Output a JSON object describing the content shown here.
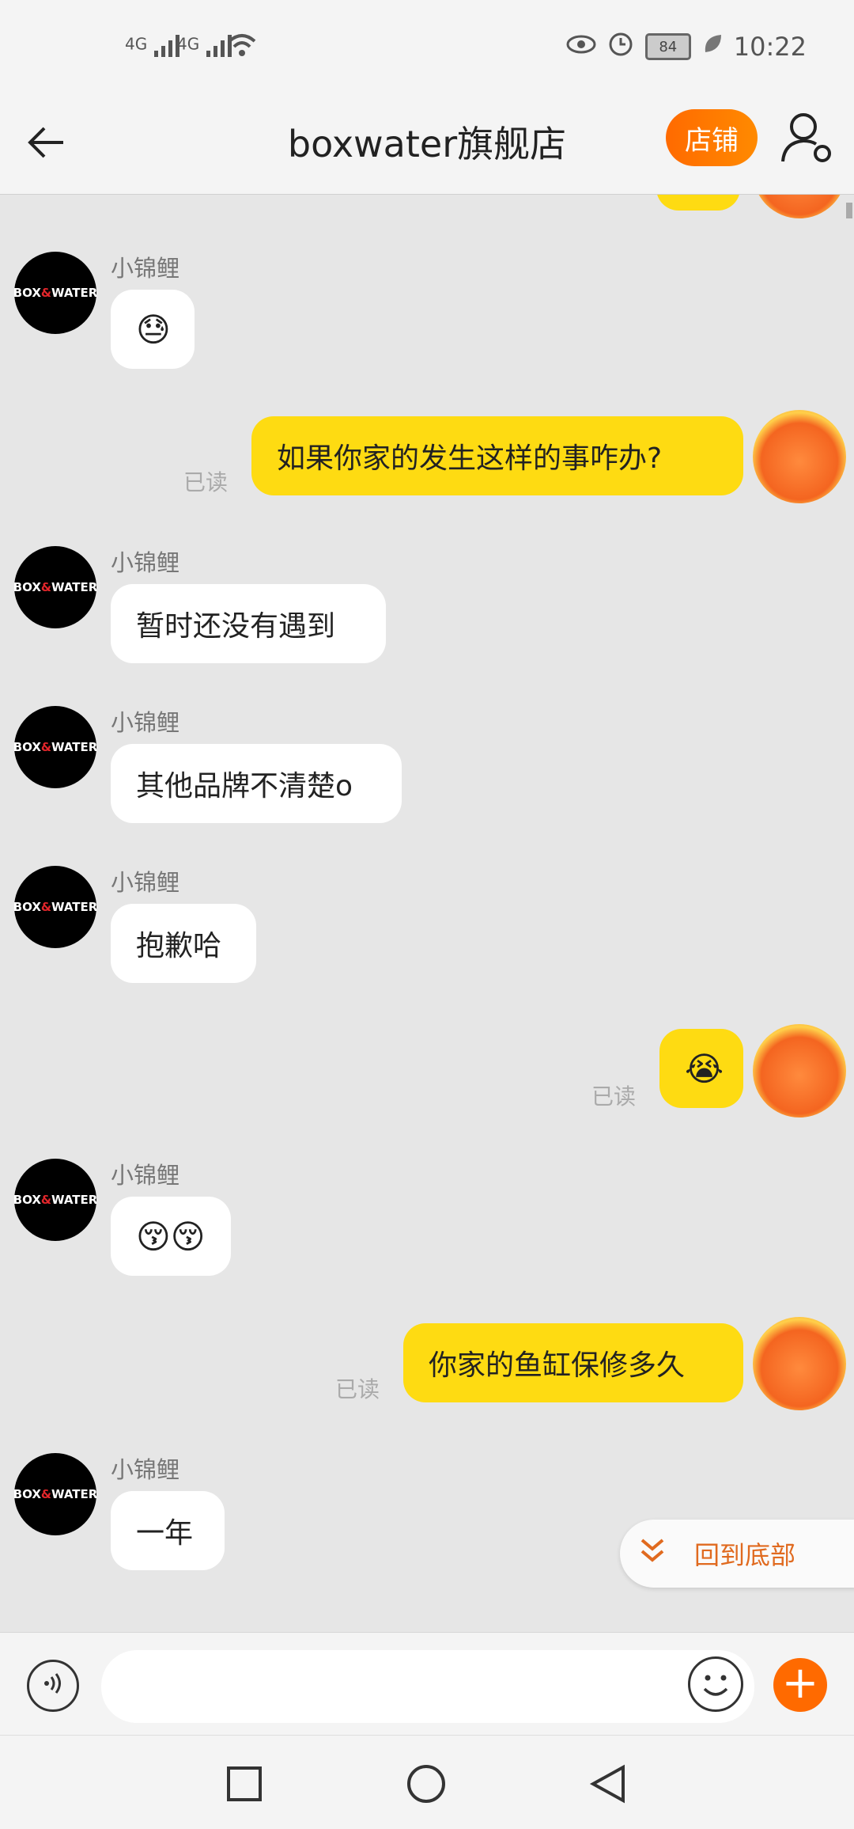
{
  "status_bar": {
    "signal1": "4G",
    "signal2": "4G",
    "battery": "84",
    "time": "10:22"
  },
  "header": {
    "title": "boxwater旗舰店",
    "shop_label": "店铺"
  },
  "shop_avatar_text": "BOX&WATER",
  "messages": [
    {
      "dir": "in",
      "sender": "小锦鲤",
      "text": "😓"
    },
    {
      "dir": "out",
      "text": "如果你家的发生这样的事咋办?",
      "read": "已读"
    },
    {
      "dir": "in",
      "sender": "小锦鲤",
      "text": "暂时还没有遇到"
    },
    {
      "dir": "in",
      "sender": "小锦鲤",
      "text": "其他品牌不清楚o"
    },
    {
      "dir": "in",
      "sender": "小锦鲤",
      "text": "抱歉哈"
    },
    {
      "dir": "out",
      "text": "😭",
      "read": "已读"
    },
    {
      "dir": "in",
      "sender": "小锦鲤",
      "text": "😚😚"
    },
    {
      "dir": "out",
      "text": "你家的鱼缸保修多久",
      "read": "已读"
    },
    {
      "dir": "in",
      "sender": "小锦鲤",
      "text": "一年"
    }
  ],
  "back_to_bottom": "回到底部",
  "input": {
    "placeholder": ""
  }
}
